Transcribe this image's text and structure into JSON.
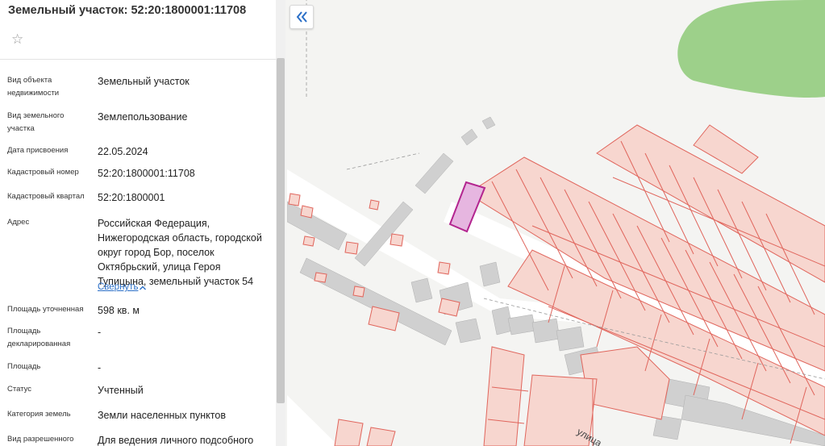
{
  "panel": {
    "title": "Земельный участок: 52:20:1800001:11708",
    "favorite_icon": "star-icon",
    "fields": [
      {
        "label": "Вид объекта недвижимости",
        "value": "Земельный участок"
      },
      {
        "label": "Вид земельного участка",
        "value": "Землепользование"
      },
      {
        "label": "Дата присвоения",
        "value": "22.05.2024"
      },
      {
        "label": "Кадастровый номер",
        "value": "52:20:1800001:11708"
      },
      {
        "label": "Кадастровый квартал",
        "value": "52:20:1800001"
      },
      {
        "label": "Адрес",
        "value": "Российская Федерация, Нижегородская область, городской округ город Бор, поселок Октябрьский, улица Героя Тупицына, земельный участок 54"
      },
      {
        "label": "Площадь уточненная",
        "value": "598 кв. м"
      },
      {
        "label": "Площадь декларированная",
        "value": "-"
      },
      {
        "label": "Площадь",
        "value": "-"
      },
      {
        "label": "Статус",
        "value": "Учтенный"
      },
      {
        "label": "Категория земель",
        "value": "Земли населенных пунктов"
      },
      {
        "label": "Вид разрешенного",
        "value": "Для ведения личного подсобного"
      }
    ],
    "collapse_label": "Свернуть",
    "collapse_icon": "chevron-up-icon"
  },
  "map": {
    "collapse_button_icon": "double-chevron-left-icon",
    "street_label": "улица",
    "colors": {
      "background": "#f4f4f2",
      "parcel_fill": "#f7d6cf",
      "parcel_stroke": "#e0655c",
      "selected_fill": "#e6b6e0",
      "selected_stroke": "#b3258f",
      "building": "#d0d0d0",
      "forest": "#9dd08a",
      "road": "#ffffff"
    }
  }
}
